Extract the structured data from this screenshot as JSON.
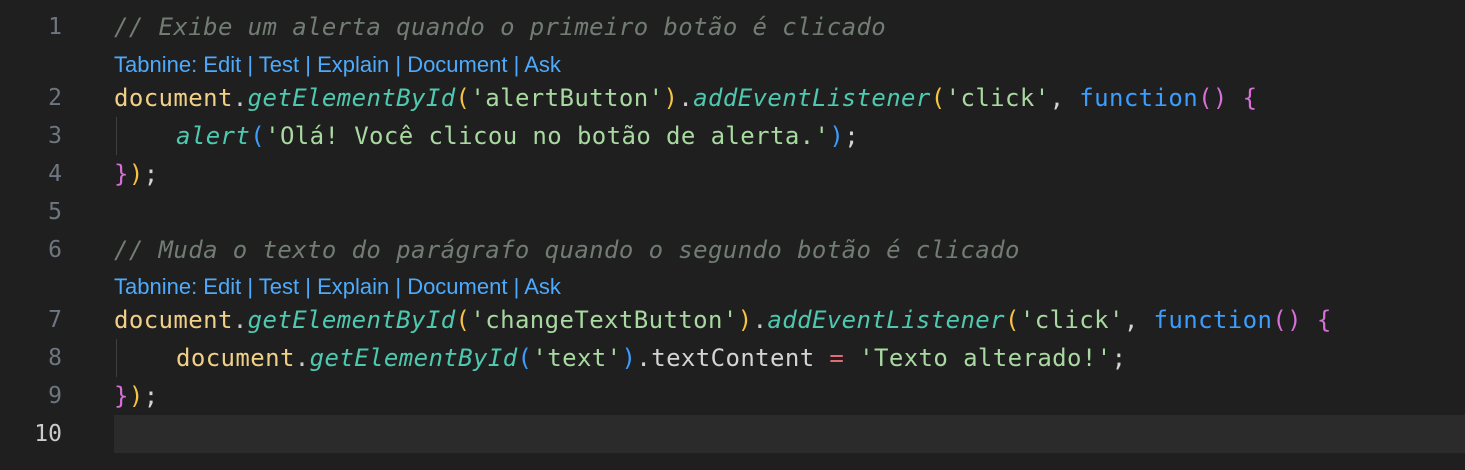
{
  "editor": {
    "lines": {
      "l1": {
        "num": "1",
        "comment": "// Exibe um alerta quando o primeiro botão é clicado"
      },
      "l2": {
        "num": "2",
        "obj": "document",
        "dot1": ".",
        "fn1": "getElementById",
        "p_open1": "(",
        "str1": "'alertButton'",
        "p_close1": ")",
        "dot2": ".",
        "fn2": "addEventListener",
        "p_open2": "(",
        "str2": "'click'",
        "comma": ", ",
        "kw": "function",
        "p_fn": "()",
        "space": " ",
        "brace": "{"
      },
      "l3": {
        "num": "3",
        "fn": "alert",
        "p_open": "(",
        "str": "'Olá! Você clicou no botão de alerta.'",
        "p_close": ")",
        "semi": ";"
      },
      "l4": {
        "num": "4",
        "brace": "}",
        "paren": ")",
        "semi": ";"
      },
      "l5": {
        "num": "5"
      },
      "l6": {
        "num": "6",
        "comment": "// Muda o texto do parágrafo quando o segundo botão é clicado"
      },
      "l7": {
        "num": "7",
        "obj": "document",
        "dot1": ".",
        "fn1": "getElementById",
        "p_open1": "(",
        "str1": "'changeTextButton'",
        "p_close1": ")",
        "dot2": ".",
        "fn2": "addEventListener",
        "p_open2": "(",
        "str2": "'click'",
        "comma": ", ",
        "kw": "function",
        "p_fn": "()",
        "space": " ",
        "brace": "{"
      },
      "l8": {
        "num": "8",
        "obj": "document",
        "dot1": ".",
        "fn": "getElementById",
        "p_open": "(",
        "str1": "'text'",
        "p_close": ")",
        "prop": ".textContent ",
        "op": "=",
        "sp": " ",
        "str2": "'Texto alterado!'",
        "semi": ";"
      },
      "l9": {
        "num": "9",
        "brace": "}",
        "paren": ")",
        "semi": ";"
      },
      "l10": {
        "num": "10"
      }
    },
    "codelens": {
      "prefix": "Tabnine: ",
      "edit": "Edit",
      "test": "Test",
      "explain": "Explain",
      "document": "Document",
      "ask": "Ask",
      "separator": " | "
    },
    "colors": {
      "background": "#1f1f1f",
      "current_line": "#2b2b2b",
      "codelens": "#4daafc",
      "keyword": "#3b9eff",
      "function": "#4ec9b0",
      "string": "#a8d9a0",
      "variable": "#f0d087"
    }
  }
}
